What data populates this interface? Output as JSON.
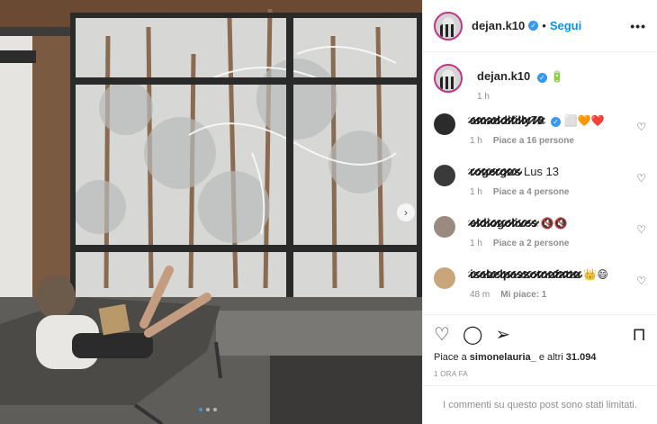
{
  "post": {
    "carousel_next_icon": "chevron-right-icon",
    "slide_count": 3,
    "active_slide": 1
  },
  "header": {
    "username": "dejan.k10",
    "separator": "•",
    "follow_label": "Segui",
    "more_label": "•••"
  },
  "caption": {
    "username": "dejan.k10",
    "emoji": "🔋",
    "time": "1 h"
  },
  "comments": [
    {
      "username": "amaddifilly78",
      "text": "⬜🧡❤️",
      "time": "1 h",
      "likes": "Piace a 16 persone",
      "avatar_color": "#2b2b2b"
    },
    {
      "username": "rogergos",
      "text": "Lus 13",
      "time": "1 h",
      "likes": "Piace a 4 persone",
      "avatar_color": "#3a3a3a"
    },
    {
      "username": "eldiogolives",
      "text": "🔇🔇",
      "time": "1 h",
      "likes": "Piace a 2 persone",
      "avatar_color": "#9a8a80"
    },
    {
      "username": "isabelpassotnofatto",
      "text": "👑😄",
      "time": "48 m",
      "likes": "Mi piace: 1",
      "avatar_color": "#c8a67a"
    }
  ],
  "actions": {
    "like_icon": "heart-outline-icon",
    "comment_icon": "comment-bubble-icon",
    "share_icon": "paper-plane-icon",
    "save_icon": "bookmark-icon",
    "likes_prefix": "Piace a",
    "likes_user": "simonelauria_",
    "likes_connector": "e altri",
    "likes_count": "31.094",
    "timestamp": "1 ORA FA",
    "comments_limited": "I commenti su questo post sono stati limitati."
  },
  "colors": {
    "accent": "#0095f6",
    "verified": "#3897f0",
    "secondary_text": "#8e8e8e"
  }
}
